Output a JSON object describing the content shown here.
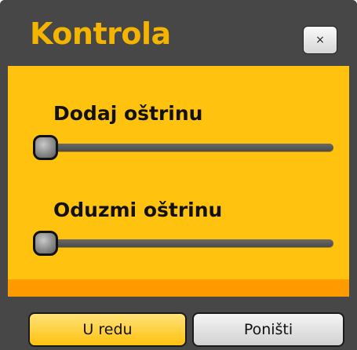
{
  "dialog": {
    "title": "Kontrola",
    "close_label": "×"
  },
  "sliders": [
    {
      "label": "Dodaj oštrinu",
      "value": 0
    },
    {
      "label": "Oduzmi oštrinu",
      "value": 0
    }
  ],
  "buttons": {
    "ok_label": "U redu",
    "cancel_label": "Poništi"
  },
  "colors": {
    "panel_gray": "#474747",
    "title_yellow": "#f5b400",
    "body_yellow": "#ffc20e",
    "strip_orange": "#ff9a00"
  }
}
